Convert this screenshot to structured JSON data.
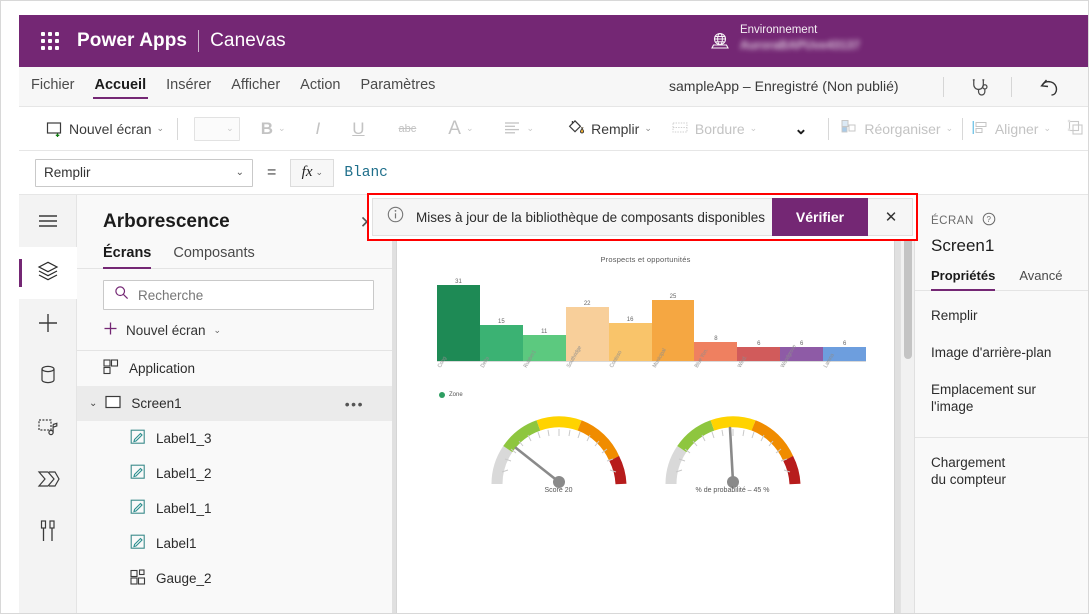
{
  "titlebar": {
    "waffle_icon": "waffle-grid-icon",
    "product": "Power Apps",
    "mode": "Canevas",
    "env_icon": "globe-icon",
    "env_label": "Environnement",
    "env_value": "AuroraBAPUve43137"
  },
  "menubar": {
    "items": [
      {
        "label": "Fichier",
        "active": false
      },
      {
        "label": "Accueil",
        "active": true
      },
      {
        "label": "Insérer",
        "active": false
      },
      {
        "label": "Afficher",
        "active": false
      },
      {
        "label": "Action",
        "active": false
      },
      {
        "label": "Paramètres",
        "active": false
      }
    ],
    "app_status": "sampleApp – Enregistré (Non publié)",
    "checker_icon": "stethoscope-app-checker-icon",
    "undo_icon": "undo-arrow-icon"
  },
  "ribbon": {
    "new_screen": "Nouvel écran",
    "font_placeholder": "",
    "bold": "B",
    "italic": "I",
    "underline": "U",
    "strikethrough": "abc",
    "font_color": "A",
    "align_icon": "align-icon",
    "fill": "Remplir",
    "border": "Bordure",
    "more_icon": "chevron-down-icon",
    "reorder": "Réorganiser",
    "align": "Aligner",
    "group_icon": "group-icon"
  },
  "formulabar": {
    "property": "Remplir",
    "equals": "=",
    "fx": "fx",
    "value": "Blanc"
  },
  "rail": {
    "items": [
      {
        "icon": "hamburger-menu-icon",
        "name": "menu",
        "selected": false
      },
      {
        "icon": "layers-tree-view-icon",
        "name": "tree-view",
        "selected": true
      },
      {
        "icon": "plus-insert-icon",
        "name": "insert",
        "selected": false
      },
      {
        "icon": "database-data-icon",
        "name": "data",
        "selected": false
      },
      {
        "icon": "media-icon",
        "name": "media",
        "selected": false
      },
      {
        "icon": "power-automate-icon",
        "name": "power-automate",
        "selected": false
      },
      {
        "icon": "advanced-tools-icon",
        "name": "advanced-tools",
        "selected": false
      }
    ]
  },
  "tree": {
    "title": "Arborescence",
    "close_icon": "close-icon",
    "tabs": [
      {
        "label": "Écrans",
        "active": true
      },
      {
        "label": "Composants",
        "active": false
      }
    ],
    "search_icon": "search-icon",
    "search_placeholder": "Recherche",
    "search_value": "",
    "new_screen": "Nouvel écran",
    "rows": [
      {
        "label": "Application",
        "icon": "app-icon",
        "level": 0,
        "selected": false,
        "caret": "",
        "menu": false
      },
      {
        "label": "Screen1",
        "icon": "screen-icon",
        "level": 0,
        "selected": true,
        "caret": "⌄",
        "menu": true
      },
      {
        "label": "Label1_3",
        "icon": "label-icon",
        "level": 1,
        "selected": false,
        "caret": "",
        "menu": false
      },
      {
        "label": "Label1_2",
        "icon": "label-icon",
        "level": 1,
        "selected": false,
        "caret": "",
        "menu": false
      },
      {
        "label": "Label1_1",
        "icon": "label-icon",
        "level": 1,
        "selected": false,
        "caret": "",
        "menu": false
      },
      {
        "label": "Label1",
        "icon": "label-icon",
        "level": 1,
        "selected": false,
        "caret": "",
        "menu": false
      },
      {
        "label": "Gauge_2",
        "icon": "gauge-component-icon",
        "level": 1,
        "selected": false,
        "caret": "",
        "menu": false
      }
    ],
    "row_menu_icon": "ellipsis-icon"
  },
  "banner": {
    "info_icon": "info-circle-icon",
    "message": "Mises à jour de la bibliothèque de composants disponibles",
    "action_label": "Vérifier",
    "close_icon": "close-icon",
    "highlight_color": "#ff0000",
    "action_color": "#742774"
  },
  "properties": {
    "kicker": "ÉCRAN",
    "help_icon": "question-circle-icon",
    "name": "Screen1",
    "tabs": [
      {
        "label": "Propriétés",
        "active": true
      },
      {
        "label": "Avancé",
        "active": false
      }
    ],
    "items": [
      "Remplir",
      "Image d'arrière-plan",
      "Emplacement sur l'image"
    ],
    "items2": [
      "Chargement\ndu compteur"
    ],
    "loading_label_line1": "Chargement",
    "loading_label_line2": "du compteur"
  },
  "chart_data": {
    "type": "bar",
    "title": "Prospects et opportunités",
    "categories": [
      "Cong",
      "Delta",
      "Rubber1",
      "Southridge",
      "Contoso",
      "Municipal",
      "Blue Yon.",
      "Wind.",
      "Woodgrove",
      "Lamna"
    ],
    "values": [
      31,
      15,
      11,
      22,
      16,
      25,
      8,
      6,
      6,
      6
    ],
    "colors": [
      "#1e8a55",
      "#3bb273",
      "#5cc97f",
      "#f8cf9a",
      "#f9c46a",
      "#f5a742",
      "#ef8060",
      "#d15b5b",
      "#8e5ba6",
      "#6d9ede"
    ],
    "legend": [
      {
        "label": "Zone",
        "color": "#2e9e62"
      }
    ],
    "legend_position": "bottom-left",
    "xlabel": "",
    "ylabel": "",
    "ylim": [
      0,
      33
    ],
    "grid": false,
    "show_values": true
  },
  "gauges": [
    {
      "name": "score-gauge",
      "caption_label": "Score",
      "caption_value": "20",
      "caption": "Score   20",
      "value": 20,
      "min": 0,
      "max": 100,
      "needle_angle_deg": -135,
      "bands": [
        {
          "color": "#d9d9d9",
          "from": 0,
          "to": 10
        },
        {
          "color": "#8ec63f",
          "from": 10,
          "to": 33
        },
        {
          "color": "#ffd300",
          "from": 33,
          "to": 55
        },
        {
          "color": "#f08c00",
          "from": 55,
          "to": 80
        },
        {
          "color": "#b71c1c",
          "from": 80,
          "to": 100
        }
      ]
    },
    {
      "name": "probability-gauge",
      "caption": "% de probabilité – 45 %",
      "value": 45,
      "min": 0,
      "max": 100,
      "needle_angle_deg": -3,
      "bands": [
        {
          "color": "#d9d9d9",
          "from": 0,
          "to": 10
        },
        {
          "color": "#8ec63f",
          "from": 10,
          "to": 33
        },
        {
          "color": "#ffd300",
          "from": 33,
          "to": 55
        },
        {
          "color": "#f08c00",
          "from": 55,
          "to": 80
        },
        {
          "color": "#b71c1c",
          "from": 80,
          "to": 100
        }
      ]
    }
  ],
  "colors": {
    "brand_purple": "#742774",
    "highlight_red": "#ff0000",
    "canvas_gray": "#e0e0e0"
  }
}
